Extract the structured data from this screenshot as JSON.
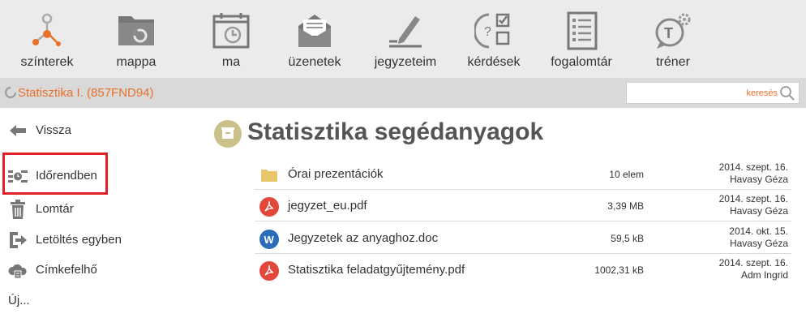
{
  "nav": [
    {
      "label": "színterek",
      "icon": "network-icon"
    },
    {
      "label": "mappa",
      "icon": "folder-icon"
    },
    {
      "label": "ma",
      "icon": "calendar-clock-icon"
    },
    {
      "label": "üzenetek",
      "icon": "envelope-icon"
    },
    {
      "label": "jegyzeteim",
      "icon": "pencil-icon"
    },
    {
      "label": "kérdések",
      "icon": "quiz-icon"
    },
    {
      "label": "fogalomtár",
      "icon": "glossary-icon"
    },
    {
      "label": "tréner",
      "icon": "trainer-icon"
    }
  ],
  "breadcrumb": {
    "label": "Statisztika I. (857FND94)"
  },
  "search": {
    "placeholder": "keresés"
  },
  "sidebar": [
    {
      "label": "Vissza",
      "icon": "arrow-left-icon"
    },
    {
      "label": "Időrendben",
      "icon": "timeline-icon"
    },
    {
      "label": "Lomtár",
      "icon": "trash-icon"
    },
    {
      "label": "Letöltés egyben",
      "icon": "download-icon"
    },
    {
      "label": "Címkefelhő",
      "icon": "tag-cloud-icon"
    },
    {
      "label": "Új..."
    }
  ],
  "page": {
    "title": "Statisztika segédanyagok"
  },
  "files": [
    {
      "name": "Órai prezentációk",
      "size": "10 elem",
      "date": "2014. szept. 16.",
      "author": "Havasy Géza",
      "icon": "folder-icon"
    },
    {
      "name": "jegyzet_eu.pdf",
      "size": "3,39 MB",
      "date": "2014. szept. 16.",
      "author": "Havasy Géza",
      "icon": "pdf-icon"
    },
    {
      "name": "Jegyzetek az anyaghoz.doc",
      "size": "59,5 kB",
      "date": "2014. okt. 15.",
      "author": "Havasy Géza",
      "icon": "word-icon"
    },
    {
      "name": "Statisztika feladatgyűjtemény.pdf",
      "size": "1002,31 kB",
      "date": "2014. szept. 16.",
      "author": "Adm Ingrid",
      "icon": "pdf-icon"
    }
  ],
  "colors": {
    "accent": "#e8712c",
    "pdf": "#e2473a",
    "word": "#2b6cb8",
    "folder": "#e8c66a",
    "highlight": "#e31e24"
  }
}
